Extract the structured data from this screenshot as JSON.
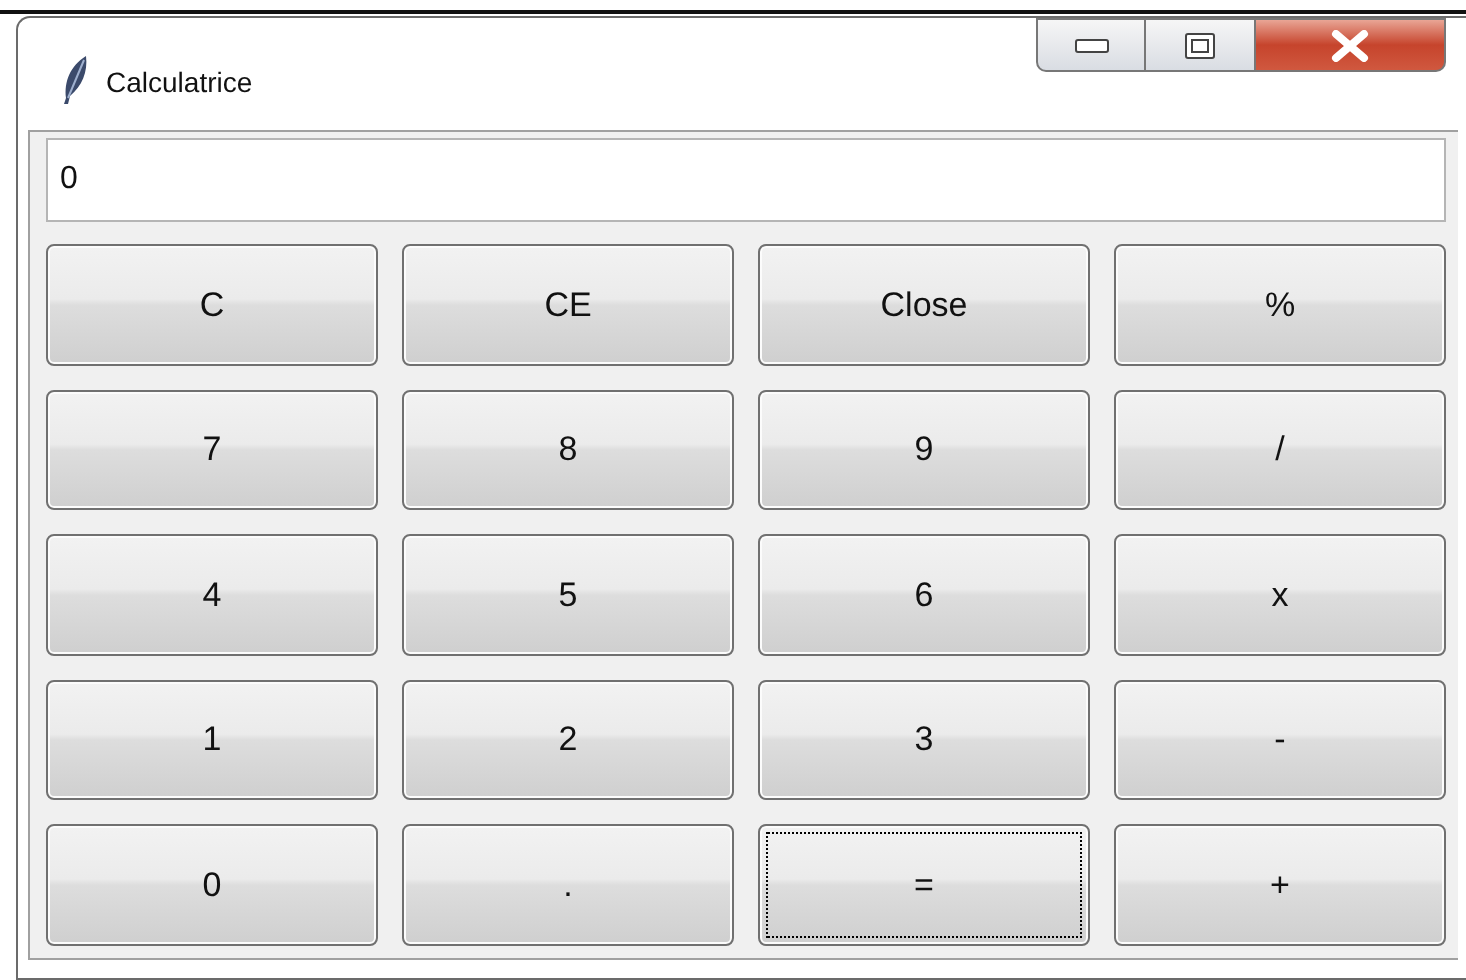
{
  "window": {
    "title": "Calculatrice"
  },
  "display": {
    "value": "0"
  },
  "buttons": [
    {
      "label": "C",
      "focused": false
    },
    {
      "label": "CE",
      "focused": false
    },
    {
      "label": "Close",
      "focused": false
    },
    {
      "label": "%",
      "focused": false
    },
    {
      "label": "7",
      "focused": false
    },
    {
      "label": "8",
      "focused": false
    },
    {
      "label": "9",
      "focused": false
    },
    {
      "label": "/",
      "focused": false
    },
    {
      "label": "4",
      "focused": false
    },
    {
      "label": "5",
      "focused": false
    },
    {
      "label": "6",
      "focused": false
    },
    {
      "label": "x",
      "focused": false
    },
    {
      "label": "1",
      "focused": false
    },
    {
      "label": "2",
      "focused": false
    },
    {
      "label": "3",
      "focused": false
    },
    {
      "label": "-",
      "focused": false
    },
    {
      "label": "0",
      "focused": false
    },
    {
      "label": ".",
      "focused": false
    },
    {
      "label": "=",
      "focused": true
    },
    {
      "label": "+",
      "focused": false
    }
  ]
}
